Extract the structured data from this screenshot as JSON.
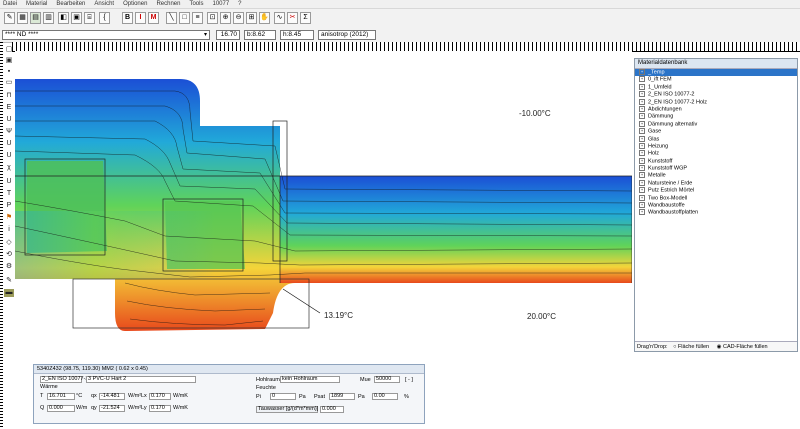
{
  "menu": [
    "Datei",
    "Material",
    "Bearbeiten",
    "Ansicht",
    "Optionen",
    "Rechnen",
    "Tools",
    "10077",
    "?"
  ],
  "toolbar": {
    "icons": [
      "pen-icon",
      "grid-icon",
      "layers-icon",
      "table-icon",
      "frame-icon",
      "select-icon",
      "bold-b-icon",
      "text-i-icon",
      "text-m-icon",
      "zoom-fit-icon",
      "zoom-in-icon",
      "zoom-out-icon",
      "zoom-window-icon",
      "zoom-1-icon",
      "pan-hand-icon",
      "curve-icon",
      "scissor-icon",
      "sigma-icon"
    ],
    "bold_label": "B",
    "italic_label": "I",
    "m_label": "M",
    "sigma_label": "Σ"
  },
  "row2": {
    "material_select": "**** ND ****",
    "value": "16.70",
    "b_value": "b:8.62",
    "h_value": "h:8.45",
    "mode": "anisotrop (2012)"
  },
  "canvas": {
    "temp_top": "-10.00°C",
    "temp_bottom": "20.00°C",
    "temp_min_label": "13.19°C"
  },
  "materials": {
    "title": "Materialdatenbank",
    "items": [
      "_Temp",
      "0_ift FEM",
      "1_Umfeld",
      "2_EN ISO 10077-2",
      "2_EN ISO 10077-2 Holz",
      "Abdichtungen",
      "Dämmung",
      "Dämmung alternativ",
      "Gase",
      "Glas",
      "Heizung",
      "Holz",
      "Kunststoff",
      "Kunststoff WGP",
      "Metalle",
      "Natursteine / Erde",
      "Putz Estrich Mörtel",
      "Two Box-Modell",
      "Wandbaustoffe",
      "Wandbaustoffplatten"
    ],
    "footer_label": "Drag'n'Drop:",
    "radio1": "Fläche füllen",
    "radio2": "CAD-Fläche füllen"
  },
  "bottom": {
    "header": "5340Z432   (98.75, 119.30) MM2   ( 0.62 x 0.45)",
    "material": "2_EN ISO 10077-2",
    "material_name": "3 PVC-U Hart 2",
    "waerme": "Wärme",
    "t_label": "T",
    "t_value": "16.701",
    "t_unit": "°C",
    "qx_label": "qx",
    "qx_value": "-14.481",
    "qx_unit": "W/m²",
    "lx_label": "Lx",
    "lx_value": "0.170",
    "lx_unit": "W/mK",
    "q_label": "Q",
    "q_value": "0.000",
    "q_unit": "W/m",
    "qy_label": "qy",
    "qy_value": "-21.524",
    "qy_unit": "W/m²",
    "ly_label": "Ly",
    "ly_value": "0.170",
    "ly_unit": "W/mK",
    "hohlraum_label": "Hohlraum",
    "hohlraum_value": "kein Hohlraum",
    "mue_label": "Mue",
    "mue_value": "50000",
    "bracket": "[ - ]",
    "feuchte": "Feuchte",
    "pi_label": "Pi",
    "pi_value": "0",
    "pa_label": "Pa",
    "psat_label": "Psat",
    "psat_value": "1899",
    "pa2_label": "Pa",
    "phi_value": "0.00",
    "percent": "%",
    "tauwasser_label": "Tauwasser [g/(d*m*mm)]",
    "tauwasser_value": "0.000"
  },
  "colors": {
    "cold": "#1b4fd6",
    "cool": "#21a9d9",
    "mid": "#5fd35a",
    "warm": "#f4d43a",
    "hot": "#e8491c"
  }
}
